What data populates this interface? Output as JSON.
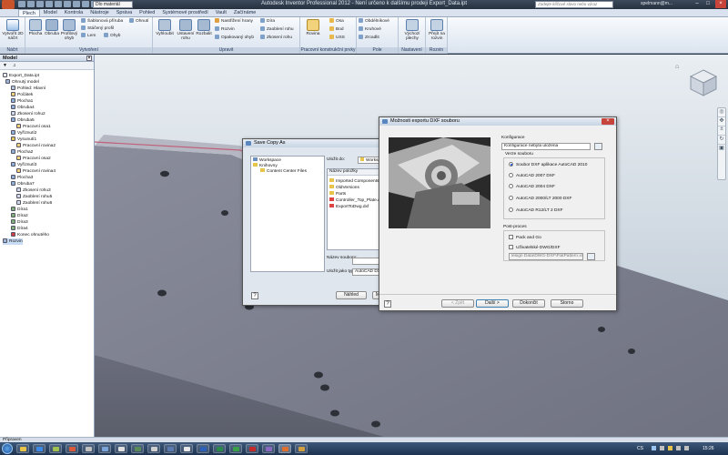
{
  "window": {
    "title": "Autodesk Inventor Professional 2012 - Není určeno k dalšímu prodeji   Export_Data.ipt",
    "project_select": "Dlo materiál",
    "search_placeholder": "Zadejte klíčové slovo nebo výraz",
    "user": "spelmann@m..."
  },
  "ribbon_tabs": [
    "Plech",
    "Model",
    "Kontrola",
    "Nástroje",
    "Správa",
    "Pohled",
    "Systémové prostředí",
    "Vault",
    "Začínáme"
  ],
  "ribbon": {
    "sketch": {
      "btn": "Vytvořit 2D náčrt",
      "label": "Náčrt"
    },
    "create": {
      "btn1": "Plocha",
      "btn2": "Obruba",
      "btn3": "Profilový ohyb",
      "small": [
        "Šablonová příruba",
        "Stáčený profil",
        "Lem",
        "Ohyb"
      ],
      "extra": "Ohnutí",
      "label": "Vytvoření"
    },
    "modify": {
      "btn1": "Vyhloubit",
      "btn2": "Ustavení rohu",
      "btn3": "Rozbalit",
      "small": [
        "Nastřižení hrany",
        "Rozvin",
        "Opakovaný ohyb",
        "Díra",
        "Zaoblení rohu",
        "Zkosení rohu"
      ],
      "label": "Upravit"
    },
    "work": {
      "btn": "Rovina",
      "small": [
        "Osa",
        "Bod",
        "USS"
      ],
      "label": "Pracovní konstrukční prvky"
    },
    "pattern": {
      "small": [
        "Obdélníkové",
        "Kruhové",
        "Zrcadlit"
      ],
      "label": "Pole"
    },
    "setup": {
      "btn": "Výchozí plechy",
      "label": "Nastavení"
    },
    "unfold": {
      "btn": "Přejít na rozvin",
      "label": "Rozvin"
    }
  },
  "browser": {
    "title": "Model",
    "items": [
      "Export_Data.ipt",
      "Ohnutý model",
      "Pohled: Hlavní",
      "Počátek",
      "Plocha1",
      "Obruba4",
      "Zkosení rohu2",
      "Obruba5",
      "Pracovní osa1",
      "Vyříznutí2",
      "Vysunutí1",
      "Pracovní rovina2",
      "Plocha2",
      "Pracovní osa2",
      "Vyříznutí3",
      "Pracovní rovina4",
      "Plocha3",
      "Obruba7",
      "Zkosení rohu3",
      "Zaoblení rohu5",
      "Zaoblení rohu6",
      "Díra1",
      "Díra2",
      "Díra3",
      "Díra4",
      "Konec ohnutého",
      "Rozvin"
    ]
  },
  "save_dialog": {
    "title": "Save Copy As",
    "places": [
      "Workspace",
      "Knihovny",
      "Content Center Files"
    ],
    "save_in_label": "Uložit do:",
    "save_in_value": "Workspace",
    "col_header": "Název položky",
    "files": [
      "Imported Components",
      "OldVersions",
      "Parts",
      "Controller_Top_Plate.dwg",
      "ExportToDwg.dxf"
    ],
    "filename_label": "Název souboru:",
    "filetype_label": "Uložit jako typ:",
    "filetype_value": "AutoCAD DXF Files (*.dxf)",
    "btn_back": "Náhled",
    "btn_m": "M"
  },
  "dxf_dialog": {
    "title": "Možnosti exportu DXF souboru",
    "config_label": "Konfigurace",
    "config_value": "Konfigurace nebyla uložena",
    "version_label": "Verze souboru",
    "versions": [
      "Soubor DXF aplikace AutoCAD 2010",
      "AutoCAD 2007 DXF",
      "AutoCAD 2004 DXF",
      "AutoCAD 2000/LT 2000 DXF",
      "AutoCAD R12/LT 2 DXF"
    ],
    "post_label": "Post-proces",
    "pack_go": "Pack and Go",
    "user_dwg": "Uživatelské DWG/DXF",
    "path": "lesign Data\\DWG-DXF\\FlatPattern.xml",
    "btn_back": "< Zpět",
    "btn_next": "Další >",
    "btn_finish": "Dokončit",
    "btn_cancel": "Storno"
  },
  "status": {
    "text": "Připraven"
  },
  "taskbar": {
    "lang": "CS",
    "clock": "15:26"
  },
  "colors": {
    "accent": "#1a53c2",
    "part": "#7c7f8e",
    "ribbon": "#dbe4ef"
  }
}
